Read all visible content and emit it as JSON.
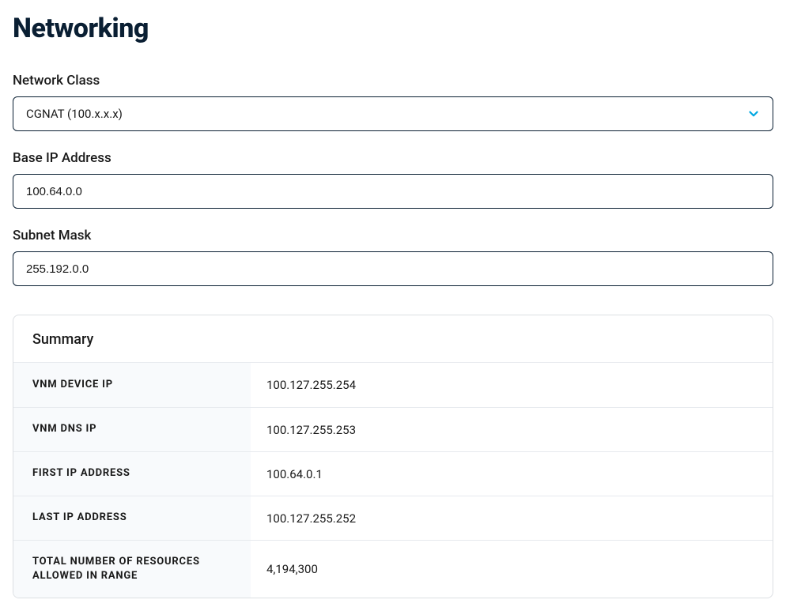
{
  "page": {
    "title": "Networking"
  },
  "form": {
    "network_class": {
      "label": "Network Class",
      "value": "CGNAT (100.x.x.x)"
    },
    "base_ip": {
      "label": "Base IP Address",
      "value": "100.64.0.0"
    },
    "subnet_mask": {
      "label": "Subnet Mask",
      "value": "255.192.0.0"
    }
  },
  "summary": {
    "header": "Summary",
    "rows": [
      {
        "key": "VNM DEVICE IP",
        "value": "100.127.255.254"
      },
      {
        "key": "VNM DNS IP",
        "value": "100.127.255.253"
      },
      {
        "key": "FIRST IP ADDRESS",
        "value": "100.64.0.1"
      },
      {
        "key": "LAST IP ADDRESS",
        "value": "100.127.255.252"
      },
      {
        "key": "TOTAL NUMBER OF RESOURCES ALLOWED IN RANGE",
        "value": "4,194,300"
      }
    ]
  }
}
